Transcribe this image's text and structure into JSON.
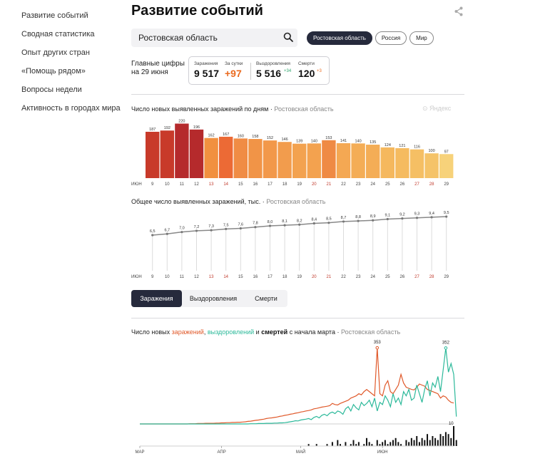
{
  "sidebar": {
    "items": [
      {
        "label": "Развитие событий",
        "active": true
      },
      {
        "label": "Сводная статистика",
        "active": false
      },
      {
        "label": "Опыт других стран",
        "active": false
      },
      {
        "label": "«Помощь рядом»",
        "active": false
      },
      {
        "label": "Вопросы недели",
        "active": false
      },
      {
        "label": "Активность в городах мира",
        "active": false
      }
    ]
  },
  "header": {
    "title": "Развитие событий",
    "share_icon": "share-icon"
  },
  "search": {
    "value": "Ростовская область",
    "icon": "search-icon"
  },
  "region_pills": [
    {
      "label": "Ростовская область",
      "active": true
    },
    {
      "label": "Россия",
      "active": false
    },
    {
      "label": "Мир",
      "active": false
    }
  ],
  "key_figures": {
    "label_line1": "Главные цифры",
    "label_line2": "на 29 июня",
    "infections_label": "Заражения",
    "infections_value": "9 517",
    "daily_label": "За сутки",
    "daily_value": "+97",
    "recoveries_label": "Выздоровления",
    "recoveries_value": "5 516",
    "recoveries_delta": "+34",
    "deaths_label": "Смерти",
    "deaths_value": "120",
    "deaths_delta": "+3"
  },
  "watermark": "Яндекс",
  "tabs": [
    {
      "label": "Заражения",
      "active": true
    },
    {
      "label": "Выздоровления",
      "active": false
    },
    {
      "label": "Смерти",
      "active": false
    }
  ],
  "colors": {
    "accent_dark": "#262a3c",
    "infections": "#e0592a",
    "recoveries": "#2cb99a",
    "deaths": "#111111",
    "weekend_tick": "#c0392b"
  },
  "chart_data": [
    {
      "type": "bar",
      "title": "Число новых выявленных заражений по дням",
      "region": "Ростовская область",
      "month_label": "ИЮН",
      "categories": [
        "9",
        "10",
        "11",
        "12",
        "13",
        "14",
        "15",
        "16",
        "17",
        "18",
        "19",
        "20",
        "21",
        "22",
        "23",
        "24",
        "25",
        "26",
        "27",
        "28",
        "29"
      ],
      "weekend_categories": [
        "13",
        "14",
        "20",
        "21",
        "27",
        "28"
      ],
      "values": [
        187,
        192,
        220,
        196,
        162,
        167,
        160,
        158,
        152,
        146,
        139,
        140,
        153,
        141,
        140,
        135,
        124,
        121,
        116,
        100,
        97
      ],
      "colors": [
        "#c83a2a",
        "#c83a2a",
        "#b52a2c",
        "#b52a2c",
        "#f1903f",
        "#ec6a35",
        "#f08c45",
        "#f19447",
        "#f2984a",
        "#f29c4d",
        "#f3a24f",
        "#f3a24f",
        "#ef8a44",
        "#f4a853",
        "#f4ad56",
        "#f4ad56",
        "#f5b85e",
        "#f5bb60",
        "#f5bf64",
        "#f5c368",
        "#f7d27a"
      ],
      "ylim": [
        0,
        230
      ]
    },
    {
      "type": "line",
      "title": "Общее число выявленных заражений, тыс.",
      "region": "Ростовская область",
      "month_label": "ИЮН",
      "categories": [
        "9",
        "10",
        "11",
        "12",
        "13",
        "14",
        "15",
        "16",
        "17",
        "18",
        "19",
        "20",
        "21",
        "22",
        "23",
        "24",
        "25",
        "26",
        "27",
        "28",
        "29"
      ],
      "weekend_categories": [
        "13",
        "14",
        "20",
        "21",
        "27",
        "28"
      ],
      "values": [
        6.5,
        6.7,
        7.0,
        7.2,
        7.3,
        7.5,
        7.6,
        7.8,
        8.0,
        8.1,
        8.2,
        8.4,
        8.5,
        8.7,
        8.8,
        8.9,
        9.1,
        9.2,
        9.3,
        9.4,
        9.5
      ],
      "value_labels": [
        "6,5",
        "6,7",
        "7,0",
        "7,2",
        "7,3",
        "7,5",
        "7,6",
        "7,8",
        "8,0",
        "8,1",
        "8,2",
        "8,4",
        "8,5",
        "8,7",
        "8,8",
        "8,9",
        "9,1",
        "9,2",
        "9,3",
        "9,4",
        "9,5"
      ],
      "ylim": [
        6.5,
        9.5
      ]
    },
    {
      "type": "line",
      "title_parts": [
        "Число новых ",
        "заражений",
        ", ",
        "выздоровлений",
        " и ",
        "смертей",
        " с начала марта"
      ],
      "region": "Ростовская область",
      "month_labels": [
        {
          "label": "МАР",
          "day_index": 0
        },
        {
          "label": "АПР",
          "day_index": 31
        },
        {
          "label": "МАЙ",
          "day_index": 61
        },
        {
          "label": "ИЮН",
          "day_index": 92
        }
      ],
      "ylim": [
        0,
        360
      ],
      "annotations": [
        {
          "series": "Заражения",
          "day_index": 90,
          "value": 353,
          "label": "353"
        },
        {
          "series": "Выздоровления",
          "day_index": 116,
          "value": 352,
          "label": "352"
        },
        {
          "series": "Смерти",
          "day_index": 118,
          "value": 10,
          "label": "10"
        }
      ],
      "series": [
        {
          "name": "Заражения",
          "color": "#e0592a",
          "values": [
            0,
            0,
            0,
            0,
            0,
            0,
            0,
            0,
            0,
            0,
            0,
            0,
            0,
            0,
            0,
            0,
            0,
            0,
            0,
            1,
            1,
            1,
            2,
            2,
            2,
            3,
            3,
            3,
            3,
            4,
            4,
            5,
            5,
            6,
            6,
            7,
            7,
            8,
            8,
            9,
            10,
            12,
            13,
            15,
            17,
            18,
            20,
            22,
            25,
            27,
            28,
            30,
            32,
            35,
            37,
            40,
            42,
            45,
            47,
            50,
            52,
            55,
            57,
            60,
            62,
            65,
            70,
            72,
            75,
            78,
            80,
            82,
            85,
            95,
            90,
            88,
            95,
            100,
            105,
            110,
            120,
            125,
            130,
            140,
            135,
            150,
            160,
            150,
            140,
            130,
            353,
            140,
            130,
            180,
            200,
            150,
            140,
            160,
            180,
            230,
            190,
            170,
            165,
            160,
            158,
            170,
            185,
            180,
            175,
            160,
            155,
            150,
            145,
            140,
            120,
            130,
            125,
            110,
            100,
            97
          ]
        },
        {
          "name": "Выздоровления",
          "color": "#2cb99a",
          "values": [
            0,
            0,
            0,
            0,
            0,
            0,
            0,
            0,
            0,
            0,
            0,
            0,
            0,
            0,
            0,
            0,
            0,
            0,
            0,
            0,
            0,
            0,
            0,
            0,
            0,
            0,
            0,
            0,
            0,
            0,
            0,
            0,
            0,
            0,
            0,
            0,
            0,
            0,
            0,
            0,
            0,
            0,
            1,
            1,
            1,
            2,
            2,
            2,
            3,
            3,
            3,
            4,
            4,
            5,
            5,
            6,
            8,
            10,
            12,
            15,
            14,
            18,
            20,
            22,
            25,
            20,
            30,
            35,
            28,
            40,
            45,
            38,
            50,
            55,
            48,
            60,
            55,
            45,
            70,
            80,
            60,
            90,
            75,
            65,
            100,
            85,
            95,
            110,
            80,
            120,
            60,
            100,
            90,
            130,
            110,
            80,
            140,
            100,
            120,
            90,
            150,
            130,
            160,
            110,
            120,
            180,
            140,
            100,
            160,
            200,
            130,
            190,
            170,
            220,
            150,
            250,
            352,
            240,
            280,
            230,
            34
          ]
        },
        {
          "name": "Смерти",
          "color": "#111111",
          "values": [
            0,
            0,
            0,
            0,
            0,
            0,
            0,
            0,
            0,
            0,
            0,
            0,
            0,
            0,
            0,
            0,
            0,
            0,
            0,
            0,
            0,
            0,
            0,
            0,
            0,
            0,
            0,
            0,
            0,
            0,
            0,
            0,
            0,
            0,
            0,
            0,
            0,
            0,
            0,
            0,
            0,
            0,
            0,
            0,
            0,
            0,
            0,
            0,
            0,
            0,
            0,
            0,
            0,
            0,
            0,
            0,
            0,
            0,
            0,
            0,
            0,
            0,
            0,
            0,
            1,
            0,
            0,
            1,
            0,
            0,
            0,
            1,
            0,
            2,
            0,
            3,
            1,
            0,
            2,
            0,
            1,
            3,
            1,
            2,
            0,
            1,
            4,
            2,
            1,
            0,
            3,
            1,
            2,
            3,
            1,
            2,
            3,
            4,
            2,
            1,
            0,
            3,
            2,
            4,
            3,
            5,
            2,
            4,
            3,
            6,
            3,
            5,
            4,
            3,
            6,
            5,
            7,
            6,
            4,
            10,
            3
          ]
        }
      ]
    }
  ]
}
